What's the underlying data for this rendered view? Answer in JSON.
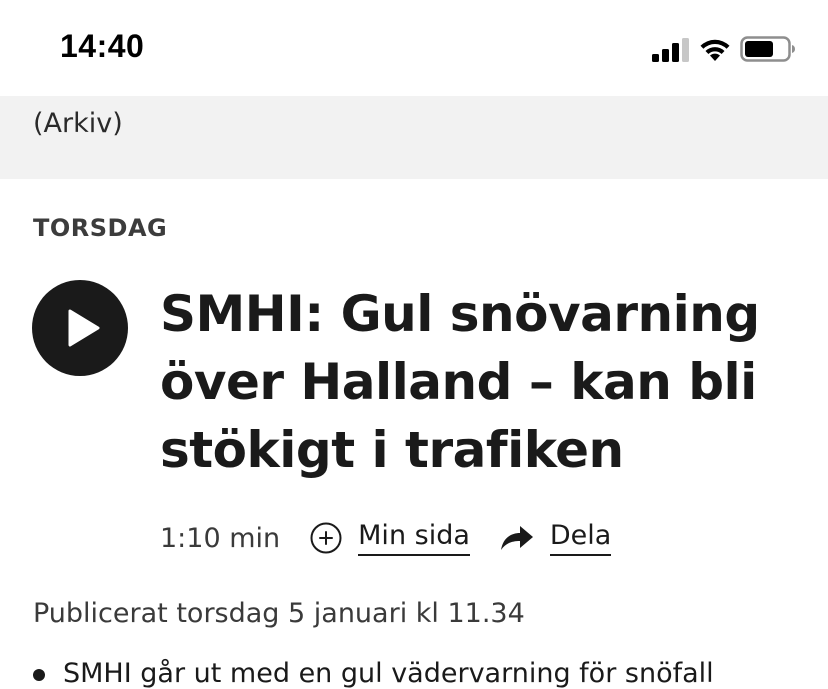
{
  "status_bar": {
    "time": "14:40",
    "icons": [
      "signal-icon",
      "wifi-icon",
      "battery-icon"
    ]
  },
  "previous_item": {
    "trailing_text": "(Arkiv)"
  },
  "article": {
    "day": "TORSDAG",
    "play_icon": "play-icon",
    "headline": "SMHI: Gul snövarning över Halland – kan bli stökigt i trafiken",
    "duration": "1:10 min",
    "my_page_label": "Min sida",
    "my_page_icon": "plus-circle-icon",
    "share_label": "Dela",
    "share_icon": "share-arrow-icon",
    "published": "Publicerat torsdag 5 januari kl 11.34",
    "bullets": [
      "SMHI går ut med en gul vädervarning för snöfall"
    ]
  },
  "colors": {
    "text": "#1a1a1a",
    "gray_strip": "#f2f2f2",
    "play_button": "#1a1a1a"
  }
}
